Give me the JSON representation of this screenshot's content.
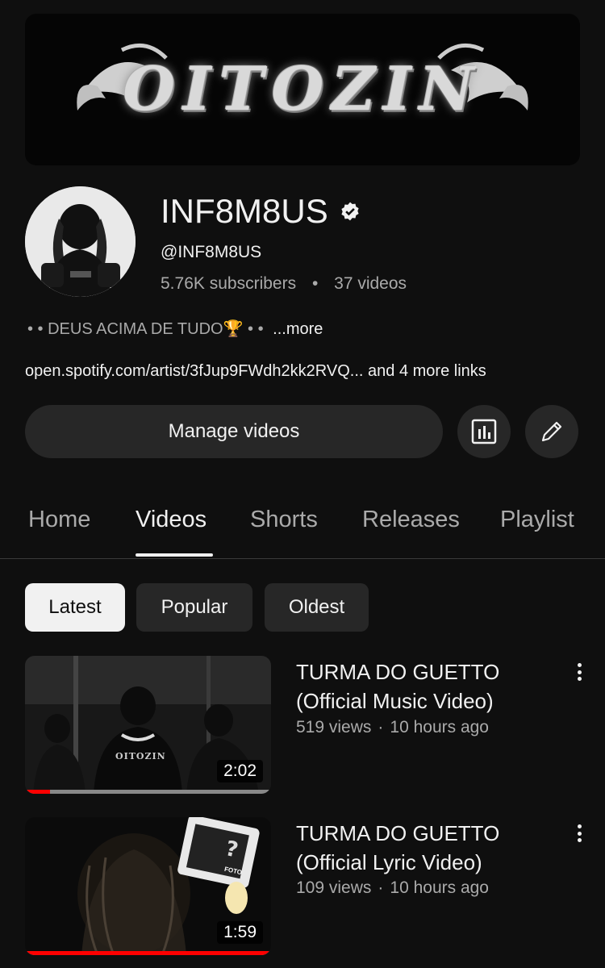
{
  "banner": {
    "text": "OITOZIN"
  },
  "channel": {
    "name": "INF8M8US",
    "handle": "@INF8M8US",
    "subscribers": "5.76K subscribers",
    "videos": "37 videos",
    "dot": "•",
    "description": "• • DEUS ACIMA DE TUDO🏆 • •",
    "more": "...more",
    "link": "open.spotify.com/artist/3fJup9FWdh2kk2RVQ...",
    "more_links": "and 4 more links"
  },
  "actions": {
    "manage_label": "Manage videos",
    "stats_icon": "analytics-icon",
    "edit_icon": "pencil-icon"
  },
  "tabs": [
    {
      "label": "Home"
    },
    {
      "label": "Videos"
    },
    {
      "label": "Shorts"
    },
    {
      "label": "Releases"
    },
    {
      "label": "Playlist"
    }
  ],
  "active_tab": "Videos",
  "chips": [
    {
      "label": "Latest"
    },
    {
      "label": "Popular"
    },
    {
      "label": "Oldest"
    }
  ],
  "active_chip": "Latest",
  "videos": [
    {
      "title_line1": "TURMA DO GUETTO",
      "title_line2": "(Official Music Video)",
      "views": "519 views",
      "age": "10 hours ago",
      "separator": "·",
      "duration": "2:02",
      "watched_fraction": 0.1,
      "thumb_text": "OITOZIN"
    },
    {
      "title_line1": "TURMA DO GUETTO",
      "title_line2": "(Official Lyric Video)",
      "views": "109 views",
      "age": "10 hours ago",
      "separator": "·",
      "duration": "1:59",
      "watched_fraction": 1.0,
      "thumb_text": "FOTO"
    }
  ],
  "colors": {
    "background": "#0f0f0f",
    "surface": "#272727",
    "text_primary": "#f1f1f1",
    "text_secondary": "#aaaaaa",
    "progress": "#ff0000"
  }
}
